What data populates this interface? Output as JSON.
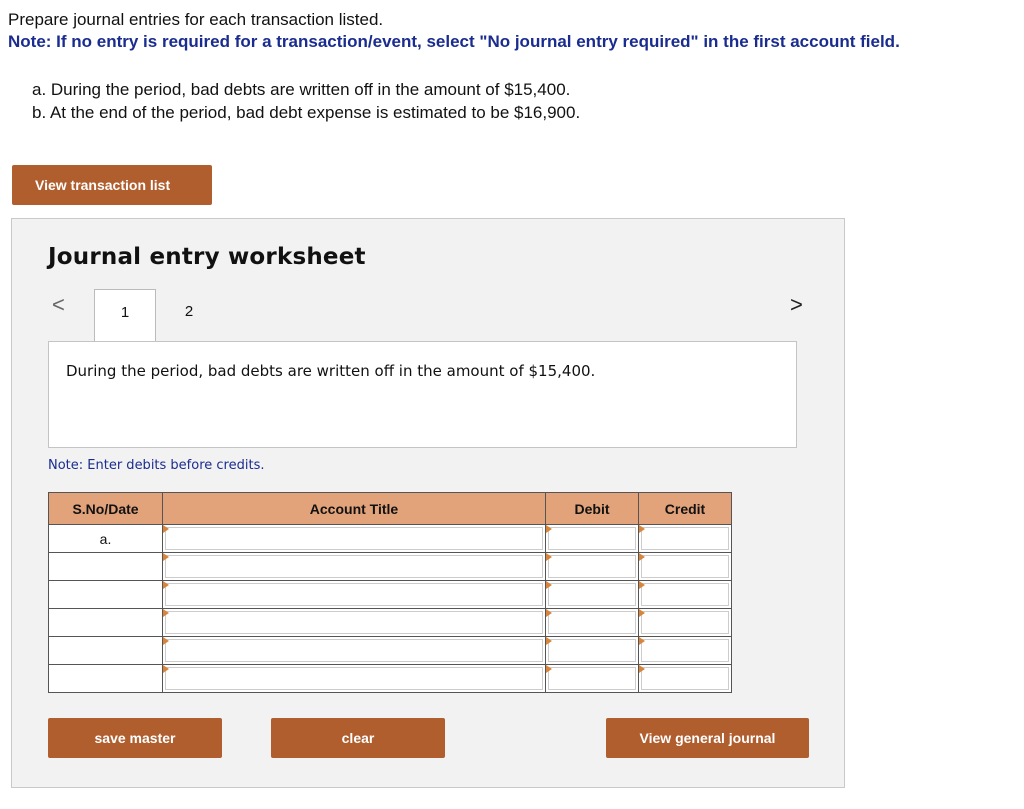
{
  "instructions": "Prepare journal entries for each transaction listed.",
  "note": "Note: If no entry is required for a transaction/event, select \"No journal entry required\" in the first account field.",
  "transactions": [
    "a. During the period, bad debts are written off in the amount of $15,400.",
    "b. At the end of the period, bad debt expense is estimated to be $16,900."
  ],
  "view_transaction_list_label": "View transaction list",
  "worksheet": {
    "title": "Journal entry worksheet",
    "nav_prev": "<",
    "nav_next": ">",
    "tabs": [
      "1",
      "2"
    ],
    "description": "During the period, bad debts are written off in the amount of $15,400.",
    "enter_note": "Note: Enter debits before credits.",
    "table": {
      "headers": [
        "S.No/Date",
        "Account Title",
        "Debit",
        "Credit"
      ],
      "rows": [
        {
          "date": "a.",
          "account": "",
          "debit": "",
          "credit": ""
        },
        {
          "date": "",
          "account": "",
          "debit": "",
          "credit": ""
        },
        {
          "date": "",
          "account": "",
          "debit": "",
          "credit": ""
        },
        {
          "date": "",
          "account": "",
          "debit": "",
          "credit": ""
        },
        {
          "date": "",
          "account": "",
          "debit": "",
          "credit": ""
        },
        {
          "date": "",
          "account": "",
          "debit": "",
          "credit": ""
        }
      ]
    },
    "buttons": {
      "save": "save master",
      "clear": "clear",
      "view_general_journal": "View general journal"
    }
  },
  "colors": {
    "button": "#b05e2e",
    "header": "#e2a27a",
    "note_text": "#1a2c8f",
    "marker": "#d9843b"
  }
}
